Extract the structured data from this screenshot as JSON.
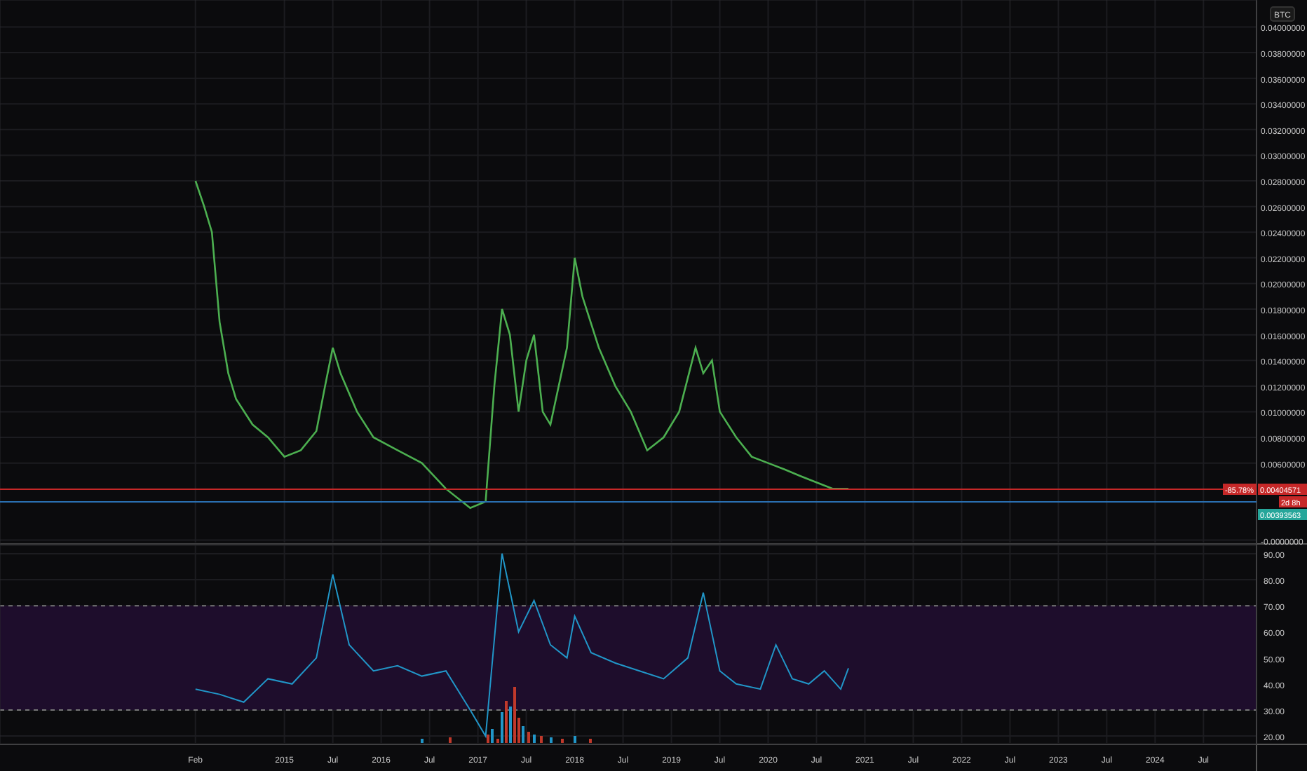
{
  "price_pane": {
    "currency_badge": "BTC",
    "badges": [
      {
        "kind": "change",
        "text": "-85.78%",
        "color": "#c62828"
      },
      {
        "kind": "price",
        "text": "0.00404571",
        "color": "#c62828"
      },
      {
        "kind": "countdown",
        "text": "2d 8h",
        "color": "#c62828"
      },
      {
        "kind": "price",
        "text": "0.00393563",
        "color": "#26a69a"
      }
    ],
    "chart_data": {
      "type": "line",
      "x": [
        2014.08,
        2014.17,
        2014.25,
        2014.33,
        2014.42,
        2014.5,
        2014.67,
        2014.83,
        2015.0,
        2015.17,
        2015.33,
        2015.42,
        2015.5,
        2015.58,
        2015.75,
        2015.92,
        2016.17,
        2016.42,
        2016.67,
        2016.92,
        2017.08,
        2017.17,
        2017.25,
        2017.33,
        2017.42,
        2017.5,
        2017.58,
        2017.67,
        2017.75,
        2017.92,
        2018.0,
        2018.08,
        2018.25,
        2018.42,
        2018.58,
        2018.75,
        2018.92,
        2019.08,
        2019.25,
        2019.33,
        2019.42,
        2019.5,
        2019.67,
        2019.83,
        2020.0,
        2020.17,
        2020.33,
        2020.5,
        2020.67,
        2020.83
      ],
      "series": [
        {
          "color": "#4caf50",
          "values": [
            0.028,
            0.026,
            0.024,
            0.017,
            0.013,
            0.011,
            0.009,
            0.008,
            0.0065,
            0.007,
            0.0085,
            0.012,
            0.015,
            0.013,
            0.01,
            0.008,
            0.007,
            0.006,
            0.004,
            0.0025,
            0.003,
            0.012,
            0.018,
            0.016,
            0.01,
            0.014,
            0.016,
            0.01,
            0.009,
            0.015,
            0.022,
            0.019,
            0.015,
            0.012,
            0.01,
            0.007,
            0.008,
            0.01,
            0.015,
            0.013,
            0.014,
            0.01,
            0.008,
            0.0065,
            0.006,
            0.0055,
            0.005,
            0.0045,
            0.004,
            0.004
          ]
        }
      ],
      "xlim": [
        2012.06,
        2025.57
      ],
      "ylim": [
        -0.0003,
        0.0421
      ],
      "yticks": [
        {
          "value": 0.04,
          "label": "0.04000000"
        },
        {
          "value": 0.038,
          "label": "0.03800000"
        },
        {
          "value": 0.036,
          "label": "0.03600000"
        },
        {
          "value": 0.034,
          "label": "0.03400000"
        },
        {
          "value": 0.032,
          "label": "0.03200000"
        },
        {
          "value": 0.03,
          "label": "0.03000000"
        },
        {
          "value": 0.028,
          "label": "0.02800000"
        },
        {
          "value": 0.026,
          "label": "0.02600000"
        },
        {
          "value": 0.024,
          "label": "0.02400000"
        },
        {
          "value": 0.022,
          "label": "0.02200000"
        },
        {
          "value": 0.02,
          "label": "0.02000000"
        },
        {
          "value": 0.018,
          "label": "0.01800000"
        },
        {
          "value": 0.016,
          "label": "0.01600000"
        },
        {
          "value": 0.014,
          "label": "0.01400000"
        },
        {
          "value": 0.012,
          "label": "0.01200000"
        },
        {
          "value": 0.01,
          "label": "0.01000000"
        },
        {
          "value": 0.008,
          "label": "0.00800000"
        },
        {
          "value": 0.006,
          "label": "0.00600000"
        },
        {
          "value": 0,
          "label": "-0.0000000"
        }
      ]
    }
  },
  "rsi_pane": {
    "chart_data": {
      "type": "line",
      "x": [
        2014.08,
        2014.33,
        2014.58,
        2014.83,
        2015.08,
        2015.33,
        2015.5,
        2015.67,
        2015.92,
        2016.17,
        2016.42,
        2016.67,
        2016.92,
        2017.08,
        2017.25,
        2017.42,
        2017.58,
        2017.75,
        2017.92,
        2018.0,
        2018.17,
        2018.42,
        2018.67,
        2018.92,
        2019.17,
        2019.33,
        2019.5,
        2019.67,
        2019.92,
        2020.08,
        2020.25,
        2020.42,
        2020.58,
        2020.75,
        2020.83
      ],
      "series": [
        {
          "color": "#2196c8",
          "values": [
            38,
            36,
            33,
            42,
            40,
            50,
            82,
            55,
            45,
            47,
            43,
            45,
            30,
            20,
            90,
            60,
            72,
            55,
            50,
            66,
            52,
            48,
            45,
            42,
            50,
            75,
            45,
            40,
            38,
            55,
            42,
            40,
            45,
            38,
            46
          ]
        }
      ],
      "xlim": [
        2012.06,
        2025.57
      ],
      "ylim": [
        6.58,
        93.2
      ],
      "xticks": [
        {
          "value": 2014.08,
          "label": "Feb"
        },
        {
          "value": 2015,
          "label": "2015"
        },
        {
          "value": 2015.5,
          "label": "Jul"
        },
        {
          "value": 2016,
          "label": "2016"
        },
        {
          "value": 2016.5,
          "label": "Jul"
        },
        {
          "value": 2017,
          "label": "2017"
        },
        {
          "value": 2017.5,
          "label": "Jul"
        },
        {
          "value": 2018,
          "label": "2018"
        },
        {
          "value": 2018.5,
          "label": "Jul"
        },
        {
          "value": 2019,
          "label": "2019"
        },
        {
          "value": 2019.5,
          "label": "Jul"
        },
        {
          "value": 2020,
          "label": "2020"
        },
        {
          "value": 2020.5,
          "label": "Jul"
        },
        {
          "value": 2021,
          "label": "2021"
        },
        {
          "value": 2021.5,
          "label": "Jul"
        },
        {
          "value": 2022,
          "label": "2022"
        },
        {
          "value": 2022.5,
          "label": "Jul"
        },
        {
          "value": 2023,
          "label": "2023"
        },
        {
          "value": 2023.5,
          "label": "Jul"
        },
        {
          "value": 2024,
          "label": "2024"
        },
        {
          "value": 2024.5,
          "label": "Jul"
        }
      ],
      "yticks": [
        {
          "value": 90,
          "label": "90.00"
        },
        {
          "value": 80,
          "label": "80.00"
        },
        {
          "value": 70,
          "label": "70.00"
        },
        {
          "value": 60,
          "label": "60.00"
        },
        {
          "value": 50,
          "label": "50.00"
        },
        {
          "value": 40,
          "label": "40.00"
        },
        {
          "value": 30,
          "label": "30.00"
        },
        {
          "value": 20,
          "label": "20.00"
        }
      ]
    }
  }
}
